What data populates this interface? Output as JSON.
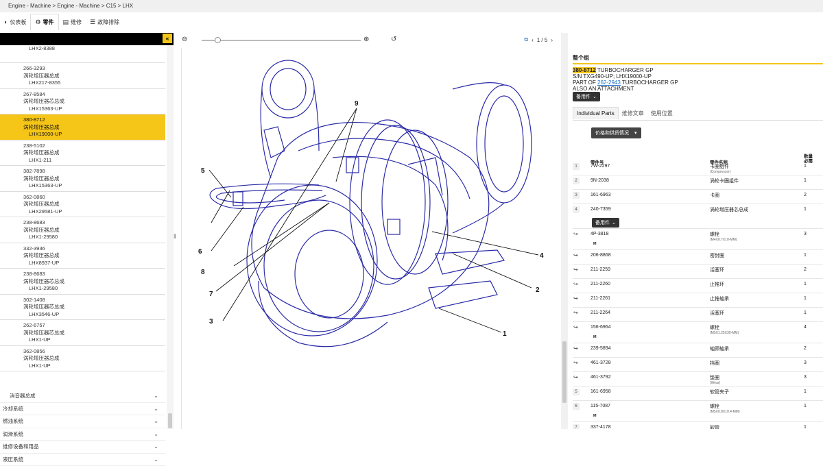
{
  "breadcrumb": "Engine - Machine > Engine - Machine > C15 > LHX",
  "tabs": [
    {
      "label": "仪表板",
      "icon": "dashboard-icon"
    },
    {
      "label": "零件",
      "icon": "gear-icon"
    },
    {
      "label": "维修",
      "icon": "book-icon"
    },
    {
      "label": "故障排除",
      "icon": "list-icon"
    }
  ],
  "left_panel": {
    "collapse_glyph": "«",
    "partial_top": "LHX2-8388",
    "items": [
      {
        "pn": "266-3293",
        "name": "涡轮增压器总成",
        "sn": "LHX217-8355"
      },
      {
        "pn": "267-8584",
        "name": "涡轮增压器芯总成",
        "sn": "LHX15363-UP"
      },
      {
        "pn": "380-8712",
        "name": "涡轮增压器总成",
        "sn": "LHX19000-UP",
        "selected": true
      },
      {
        "pn": "238-5102",
        "name": "涡轮增压器总成",
        "sn": "LHX1-211"
      },
      {
        "pn": "382-7898",
        "name": "涡轮增压器总成",
        "sn": "LHX15363-UP"
      },
      {
        "pn": "362-0860",
        "name": "涡轮增压器总成",
        "sn": "LHX29581-UP"
      },
      {
        "pn": "238-8683",
        "name": "涡轮增压器总成",
        "sn": "LHX1-29580"
      },
      {
        "pn": "332-3936",
        "name": "涡轮增压器总成",
        "sn": "LHX8937-UP"
      },
      {
        "pn": "238-8683",
        "name": "涡轮增压器芯总成",
        "sn": "LHX1-29580"
      },
      {
        "pn": "302-1408",
        "name": "涡轮增压器芯总成",
        "sn": "LHX3546-UP"
      },
      {
        "pn": "262-6757",
        "name": "涡轮增压器芯总成",
        "sn": "LHX1-UP"
      },
      {
        "pn": "362-0856",
        "name": "涡轮增压器总成",
        "sn": "LHX1-UP"
      }
    ],
    "groups": [
      {
        "label": "消音器总成",
        "sub": true
      },
      {
        "label": "冷却系统"
      },
      {
        "label": "燃油系统"
      },
      {
        "label": "润滑系统"
      },
      {
        "label": "维修设备和用品"
      },
      {
        "label": "液压系统"
      }
    ]
  },
  "viewer": {
    "page": "1 / 5",
    "zoom_fraction": 0.1,
    "callouts": [
      "1",
      "2",
      "3",
      "4",
      "5",
      "6",
      "7",
      "8",
      "9"
    ]
  },
  "detail": {
    "section_title": "整个组",
    "part_number": "380-8712",
    "part_title": " TURBOCHARGER GP",
    "sn_line": "S/N TXG490-UP; LHX19000-UP",
    "part_of_prefix": "PART OF ",
    "part_of_number": "262-2943",
    "part_of_suffix": " TURBOCHARGER GP",
    "attachment_line": "ALSO AN ATTACHMENT",
    "options_btn": "备用件",
    "tabs": [
      "Individual Parts",
      "维修文章",
      "使用位置"
    ],
    "price_btn": "价格和供货情况",
    "col_pn": "零件号",
    "col_name": "零件名称",
    "col_qty_1": "数量",
    "col_qty_2": "必需",
    "rows": [
      {
        "idx": "1",
        "pn": "7W-2297",
        "name": "卡圈组件",
        "sub": "(Compressor)",
        "qty": "1"
      },
      {
        "idx": "2",
        "pn": "9N-2038",
        "name": "涡轮卡圈组件",
        "qty": "1"
      },
      {
        "idx": "3",
        "pn": "161-6963",
        "name": "卡圈",
        "qty": "2"
      },
      {
        "idx": "4",
        "pn": "240-7359",
        "name": "涡轮增压器芯总成",
        "qty": "1",
        "options": "备用件"
      },
      {
        "child": true,
        "pn": "4P-3818",
        "name": "螺栓",
        "sub": "(M4X0.7X10-MM)",
        "qty": "3",
        "m": "M"
      },
      {
        "child": true,
        "pn": "206-8868",
        "name": "密封圈",
        "qty": "1"
      },
      {
        "child": true,
        "pn": "211-2259",
        "name": "活塞环",
        "qty": "2"
      },
      {
        "child": true,
        "pn": "211-2260",
        "name": "止推环",
        "qty": "1"
      },
      {
        "child": true,
        "pn": "211-2261",
        "name": "止推轴承",
        "qty": "1"
      },
      {
        "child": true,
        "pn": "211-2264",
        "name": "活塞环",
        "qty": "1"
      },
      {
        "child": true,
        "pn": "156-6964",
        "name": "螺栓",
        "sub": "(M5X1.25X30-MM)",
        "qty": "4",
        "m": "M"
      },
      {
        "child": true,
        "pn": "239-5894",
        "name": "轴颈轴承",
        "qty": "2"
      },
      {
        "child": true,
        "pn": "461-3728",
        "name": "挡圈",
        "qty": "3"
      },
      {
        "child": true,
        "pn": "461-3792",
        "name": "垫圈",
        "sub": "(Wear)",
        "qty": "3"
      },
      {
        "idx": "5",
        "pn": "161-6958",
        "name": "软管夹子",
        "qty": "1"
      },
      {
        "idx": "6",
        "pn": "115-7087",
        "name": "螺栓",
        "sub": "(M5X0.8X10.4-MM)",
        "qty": "1",
        "m": "M"
      },
      {
        "idx": "7",
        "pn": "337-4178",
        "name": "软管",
        "qty": "1"
      }
    ]
  }
}
